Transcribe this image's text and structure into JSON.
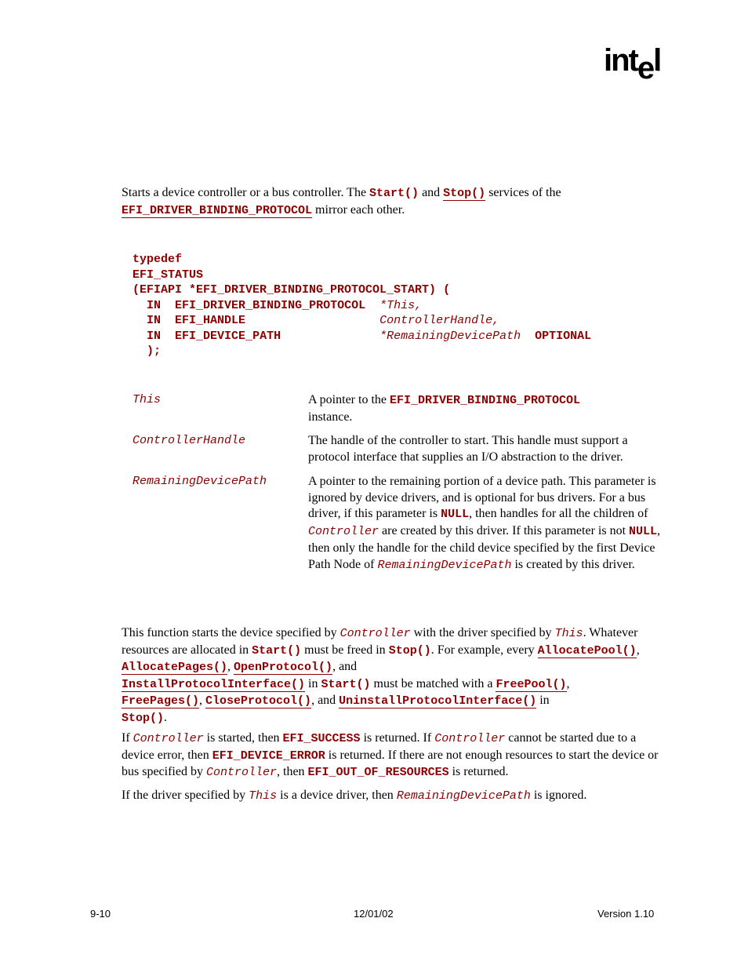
{
  "header": {
    "logo": {
      "brand": "int",
      "brand_e": "e",
      "brand_end": "l",
      "registered": "®"
    }
  },
  "summary": {
    "t1": "Starts a device controller or a bus controller.  The ",
    "start": "Start()",
    "t2": " and ",
    "stop": "Stop()",
    "t3": " services of the",
    "protocol": "EFI_DRIVER_BINDING_PROTOCOL",
    "t4": " mirror each other."
  },
  "prototype": {
    "line1": "typedef",
    "line2": "EFI_STATUS",
    "line3": "(EFIAPI *EFI_DRIVER_BINDING_PROTOCOL_START) (",
    "args": [
      {
        "dir": "IN",
        "type": "EFI_DRIVER_BINDING_PROTOCOL",
        "name": "*This,",
        "extra": ""
      },
      {
        "dir": "IN",
        "type": "EFI_HANDLE",
        "name": "ControllerHandle,",
        "extra": ""
      },
      {
        "dir": "IN",
        "type": "EFI_DEVICE_PATH",
        "name": "*RemainingDevicePath",
        "extra": "OPTIONAL"
      }
    ],
    "close": ");"
  },
  "parameters": [
    {
      "name": "This",
      "d1": "A pointer to the ",
      "d_code": "EFI_DRIVER_BINDING_PROTOCOL",
      "d2": "instance."
    },
    {
      "name": "ControllerHandle",
      "desc": "The handle of the controller to start.  This handle must support a protocol interface that supplies an I/O abstraction to the driver."
    },
    {
      "name": "RemainingDevicePath",
      "d1": "A pointer to the remaining portion of a device path.  This parameter is ignored by device drivers, and is optional for bus drivers. For a bus driver, if this parameter is ",
      "null1": "NULL",
      "d2": ", then handles for all the children of ",
      "ctrl": "Controller",
      "d3": " are created by this driver. If this parameter is not ",
      "null2": "NULL",
      "d4": ", then only the handle for the child device specified by the first Device Path Node of ",
      "rdp": "RemainingDevicePath",
      "d5": " is created by this driver."
    }
  ],
  "description": {
    "p1": {
      "a": "This function starts the device specified by ",
      "ctrl": "Controller",
      "b": " with the driver specified by ",
      "this": "This",
      "c": ". Whatever resources are allocated in ",
      "start": "Start()",
      "d": " must be freed in ",
      "stop": "Stop()",
      "e": ".  For example, every ",
      "allocpool": "AllocatePool()",
      "sep1": ", ",
      "allocpages": "AllocatePages()",
      "sep2": ", ",
      "openproto": "OpenProtocol()",
      "f": ", and ",
      "installpi": "InstallProtocolInterface()",
      "g": " in ",
      "start2": "Start()",
      "h": " must be matched with a ",
      "freepool": "FreePool()",
      "sep3": ", ",
      "freepages": "FreePages()",
      "sep4": ", ",
      "closeproto": "CloseProtocol()",
      "i": ", and ",
      "uninstallpi": "UninstallProtocolInterface()",
      "j": " in ",
      "stop2": "Stop()",
      "k": "."
    },
    "p2": {
      "a": "If ",
      "ctrl1": "Controller",
      "b": " is started, then ",
      "success": "EFI_SUCCESS",
      "c": " is returned.  If ",
      "ctrl2": "Controller",
      "d": " cannot be started due to a device error, then  ",
      "deverr": "EFI_DEVICE_ERROR",
      "e": " is returned.  If there are not enough resources to start the device or bus specified by ",
      "ctrl3": "Controller",
      "f": ", then ",
      "oor": "EFI_OUT_OF_RESOURCES",
      "g": " is returned."
    },
    "p3": {
      "a": "If the driver specified by ",
      "this": "This",
      "b": " is a device driver, then ",
      "rdp": "RemainingDevicePath",
      "c": " is ignored."
    }
  },
  "footer": {
    "page": "9-10",
    "date": "12/01/02",
    "version": "Version 1.10"
  }
}
